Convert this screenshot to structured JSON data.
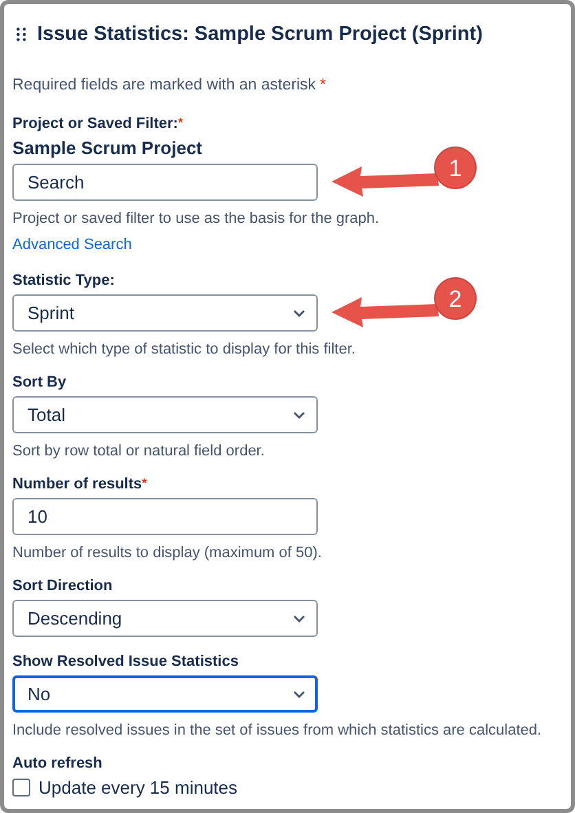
{
  "panel": {
    "title": "Issue Statistics: Sample Scrum Project (Sprint)"
  },
  "required_note": {
    "text": "Required fields are marked with an asterisk",
    "asterisk": "*"
  },
  "fields": [
    {
      "kind": "picker",
      "label": "Project or Saved Filter:",
      "asterisk": "*",
      "selection": "Sample Scrum Project",
      "value": "Search",
      "help": "Project or saved filter to use as the basis for the graph.",
      "link": "Advanced Search",
      "callout": "1"
    },
    {
      "kind": "select",
      "label": "Statistic Type:",
      "value": "Sprint",
      "focused": false,
      "help": "Select which type of statistic to display for this filter.",
      "callout": "2"
    },
    {
      "kind": "select",
      "label": "Sort By",
      "value": "Total",
      "focused": false,
      "help": "Sort by row total or natural field order."
    },
    {
      "kind": "number",
      "label": "Number of results",
      "asterisk": "*",
      "value": "10",
      "help": "Number of results to display (maximum of 50)."
    },
    {
      "kind": "select",
      "label": "Sort Direction",
      "value": "Descending",
      "focused": false
    },
    {
      "kind": "select",
      "label": "Show Resolved Issue Statistics",
      "value": "No",
      "focused": true,
      "help": "Include resolved issues in the set of issues from which statistics are calculated."
    },
    {
      "kind": "checkbox",
      "label": "Auto refresh",
      "option": "Update every 15 minutes",
      "checked": false
    }
  ]
}
